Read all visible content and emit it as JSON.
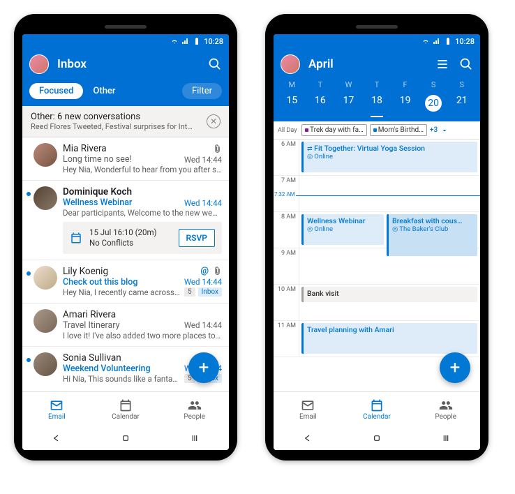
{
  "status": {
    "time": "10:28"
  },
  "inbox": {
    "title": "Inbox",
    "tabs": {
      "focused": "Focused",
      "other": "Other",
      "filter": "Filter"
    },
    "banner": {
      "title": "Other: 6 new conversations",
      "subtitle": "Reed Flores Tweeted, Festival surprises for Int…"
    },
    "emails": [
      {
        "sender": "Mia Rivera",
        "subject": "Long time no see!",
        "time": "Wed 14:44",
        "preview": "Hey Nia, Wonderful to hear from you after such…",
        "unread": false,
        "bold": false,
        "attach": true
      },
      {
        "sender": "Dominique Koch",
        "subject": "Wellness Webinar",
        "time": "Wed 14:44",
        "preview": "Dear participants, Welcome to the new webinar…",
        "unread": true,
        "bold": true,
        "attach": false,
        "rsvp": {
          "line1": "15 Jul 16:10 (20m)",
          "line2": "No Conflicts",
          "button": "RSVP"
        }
      },
      {
        "sender": "Lily Koenig",
        "subject": "Check out this blog",
        "time": "Wed 14:44",
        "preview": "Hey Nia, I recently came across this…",
        "unread": true,
        "bold": false,
        "attach": true,
        "mention": true,
        "badges": [
          "5",
          "Inbox"
        ]
      },
      {
        "sender": "Amari Rivera",
        "subject": "Travel Itinerary",
        "time": "Wed 14:44",
        "preview": "I love it! I've also added two more places to vis…",
        "unread": false,
        "bold": false,
        "attach": false
      },
      {
        "sender": "Sonia Sullivan",
        "subject": "Weekend Volunteering",
        "time": "Wed 14:44",
        "preview": "Hi Nia, This sounds like a fantastic…",
        "unread": true,
        "bold": false,
        "attach": false,
        "badges": [
          "5",
          "Inbox"
        ]
      }
    ]
  },
  "calendar": {
    "title": "April",
    "days": [
      "M",
      "T",
      "W",
      "T",
      "F",
      "S",
      "S"
    ],
    "dates": [
      "15",
      "16",
      "17",
      "18",
      "19",
      "20",
      "21"
    ],
    "selected_index": 5,
    "today_index": 3,
    "allday": {
      "label": "All Day",
      "chips": [
        "Trek day with fa…",
        "Mom's Birthd…"
      ],
      "more": "+3"
    },
    "now": "7:32 AM",
    "hours": [
      "6 AM",
      "7 AM",
      "8 AM",
      "9 AM",
      "10 AM",
      "11 AM"
    ],
    "events": [
      {
        "title": "Fit Together: Virtual Yoga Session",
        "loc": "Online"
      },
      {
        "title": "Wellness Webinar",
        "loc": "Online"
      },
      {
        "title": "Breakfast with cous…",
        "loc": "The Baker's Club"
      },
      {
        "title": "Bank visit",
        "loc": ""
      },
      {
        "title": "Travel planning with Amari",
        "loc": ""
      }
    ]
  },
  "nav": {
    "email": "Email",
    "calendar": "Calendar",
    "people": "People"
  }
}
